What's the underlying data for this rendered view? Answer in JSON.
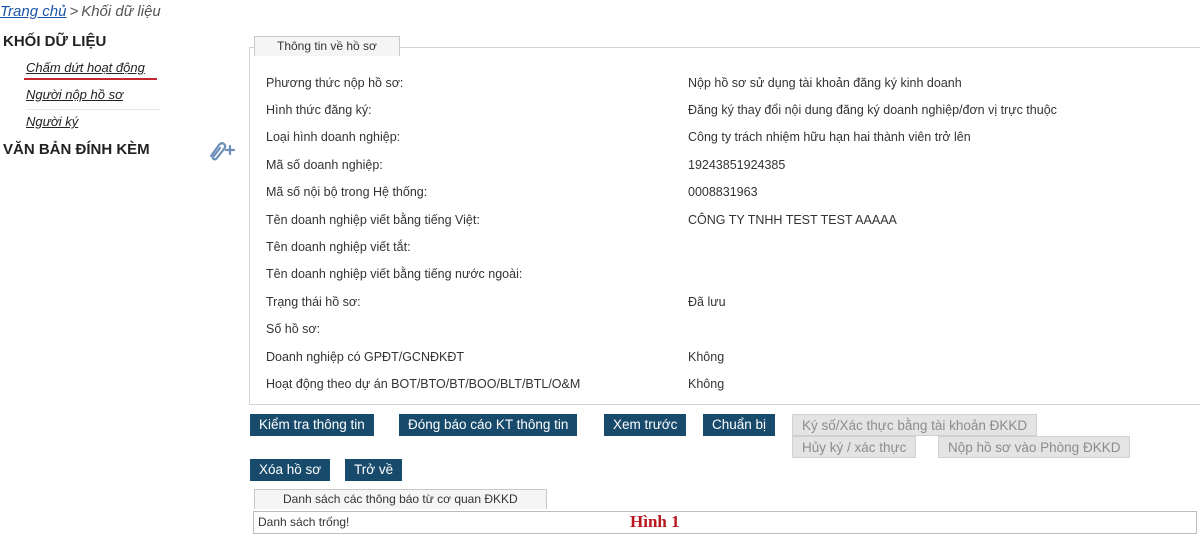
{
  "breadcrumb": {
    "home": "Trang chủ",
    "separator": ">",
    "current": "Khối dữ liệu"
  },
  "sidebar": {
    "section_title": "KHỐI DỮ LIỆU",
    "items": [
      {
        "label": "Chấm dứt hoạt động",
        "active": true
      },
      {
        "label": "Người nộp hồ sơ"
      },
      {
        "label": "Người ký"
      }
    ],
    "attachments_title": "VĂN BẢN ĐÍNH KÈM",
    "attach_icon": "paperclip-plus-icon"
  },
  "info": {
    "legend": "Thông tin về hồ sơ",
    "rows": [
      {
        "label": "Phương thức nộp hồ sơ:",
        "value": "Nộp hồ sơ sử dụng tài khoản đăng ký kinh doanh"
      },
      {
        "label": "Hình thức đăng ký:",
        "value": "Đăng ký thay đổi nội dung đăng ký doanh nghiệp/đơn vị trực thuộc"
      },
      {
        "label": "Loại hình doanh nghiệp:",
        "value": "Công ty trách nhiệm hữu hạn hai thành viên trở lên"
      },
      {
        "label": "Mã số doanh nghiệp:",
        "value": "19243851924385"
      },
      {
        "label": "Mã số nội bộ trong Hệ thống:",
        "value": "0008831963"
      },
      {
        "label": "Tên doanh nghiệp viết bằng tiếng Việt:",
        "value": "CÔNG TY TNHH TEST TEST AAAAA"
      },
      {
        "label": "Tên doanh nghiệp viết tắt:",
        "value": ""
      },
      {
        "label": "Tên doanh nghiệp viết bằng tiếng nước ngoài:",
        "value": ""
      },
      {
        "label": "Trạng thái hồ sơ:",
        "value": "Đã lưu"
      },
      {
        "label": "Số hồ sơ:",
        "value": ""
      },
      {
        "label": "Doanh nghiệp có GPĐT/GCNĐKĐT",
        "value": "Không"
      },
      {
        "label": "Hoạt động theo dự án BOT/BTO/BT/BOO/BLT/BTL/O&M",
        "value": "Không"
      }
    ]
  },
  "buttons": {
    "check": "Kiểm tra thông tin",
    "close_report": "Đóng báo cáo KT thông tin",
    "preview": "Xem trước",
    "prepare": "Chuẩn bị",
    "sign": "Ký số/Xác thực bằng tài khoản ĐKKD",
    "cancel_sign": "Hủy ký / xác thực",
    "submit": "Nộp hồ sơ vào Phòng ĐKKD",
    "delete": "Xóa hồ sơ",
    "back": "Trở về"
  },
  "notifications": {
    "legend": "Danh sách các thông báo từ cơ quan ĐKKD",
    "empty_text": "Danh sách trống!"
  },
  "figure_caption": "Hình 1",
  "colors": {
    "button_primary": "#184a6c",
    "button_disabled": "#e4e4e4",
    "link": "#1a55a8",
    "active_underline": "#c4262e",
    "caption": "#b8171e"
  }
}
